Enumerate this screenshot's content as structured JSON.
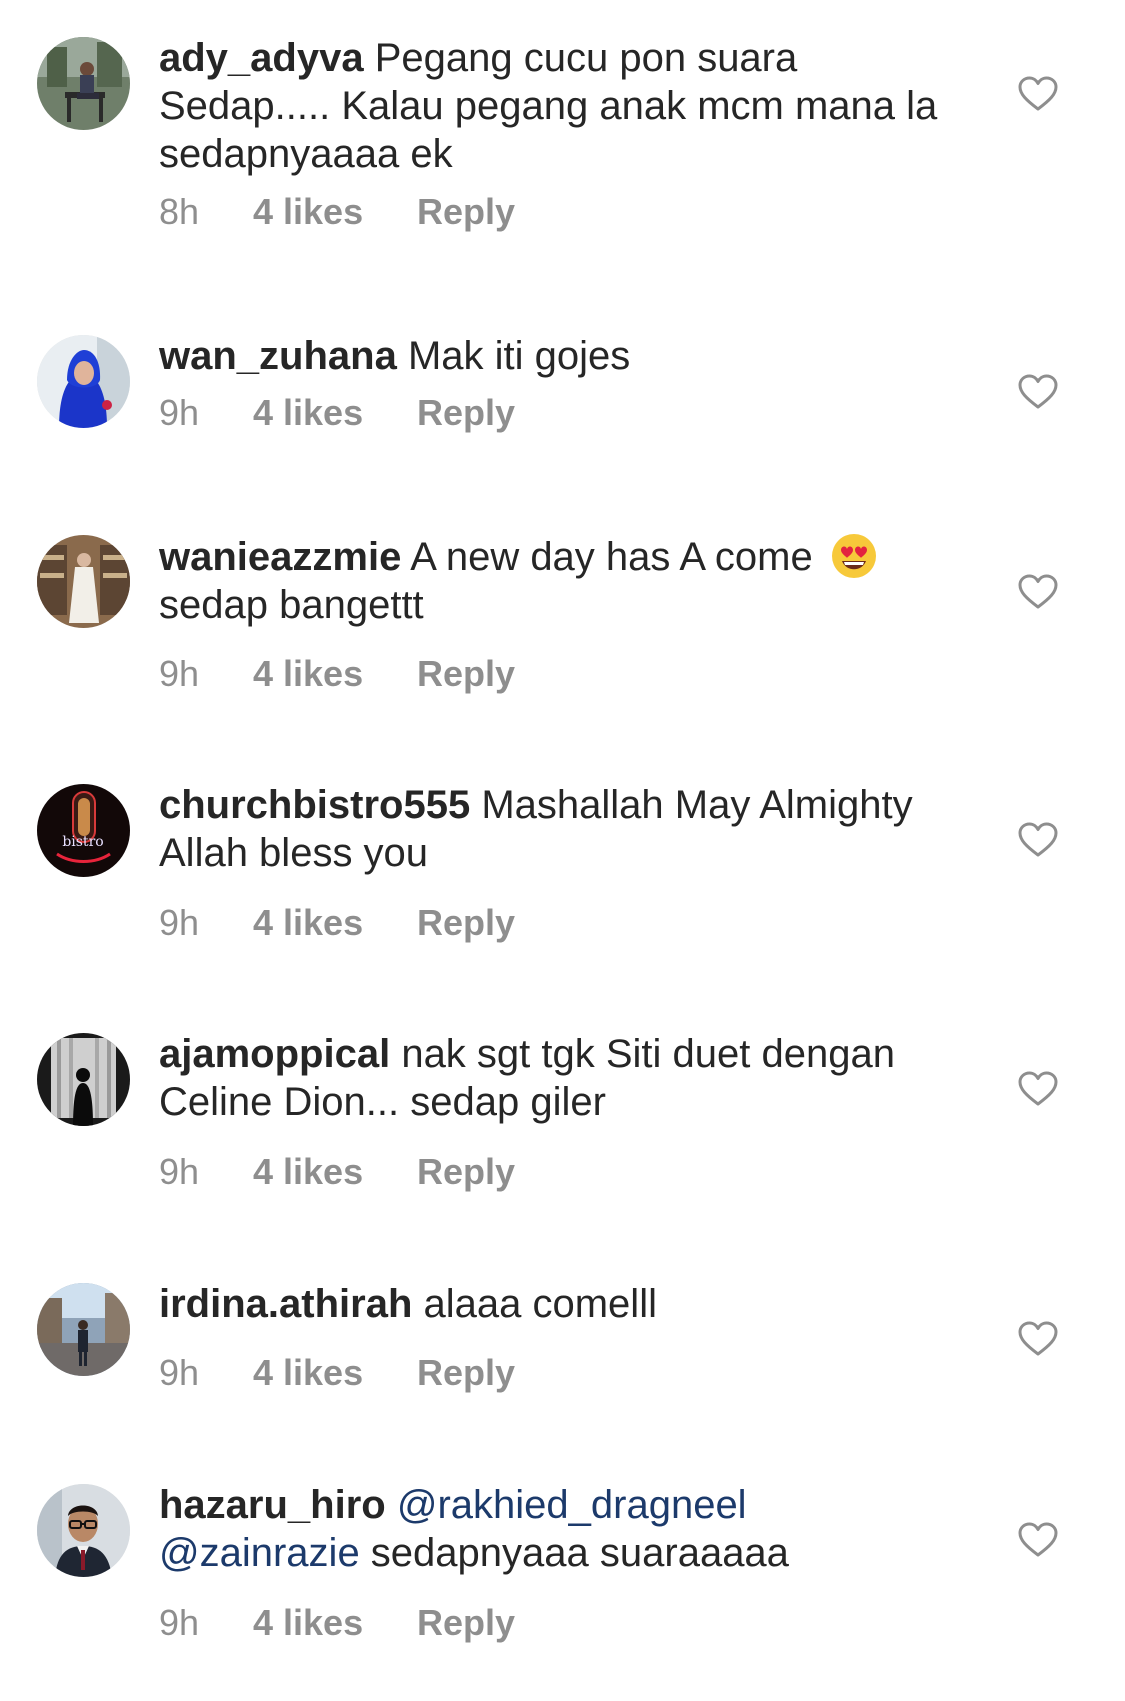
{
  "comments": [
    {
      "username": "ady_adyva",
      "text": " Pegang cucu pon suara Sedap..... Kalau pegang anak mcm mana la sedapnyaaaa ek",
      "time": "8h",
      "likes": "4 likes",
      "reply": "Reply",
      "avatar_icon": "avatar-man-sitting-bench"
    },
    {
      "username": "wan_zuhana",
      "text": " Mak iti gojes",
      "time": "9h",
      "likes": "4 likes",
      "reply": "Reply",
      "avatar_icon": "avatar-woman-blue-hijab"
    },
    {
      "username": "wanieazzmie",
      "text": " A new day has A come ",
      "text_after_emoji": "sedap bangettt",
      "emoji": "heart-eyes-emoji",
      "time": "9h",
      "likes": "4 likes",
      "reply": "Reply",
      "avatar_icon": "avatar-woman-white-dress-library"
    },
    {
      "username": "churchbistro555",
      "text": " Mashallah May Almighty Allah bless you",
      "time": "9h",
      "likes": "4 likes",
      "reply": "Reply",
      "avatar_icon": "avatar-bistro-neon-sign",
      "avatar_text": "bistro"
    },
    {
      "username": "ajamoppical",
      "text": " nak sgt tgk Siti duet dengan Celine Dion... sedap giler",
      "time": "9h",
      "likes": "4 likes",
      "reply": "Reply",
      "avatar_icon": "avatar-silhouette-window"
    },
    {
      "username": "irdina.athirah",
      "text": " alaaa comelll",
      "time": "9h",
      "likes": "4 likes",
      "reply": "Reply",
      "avatar_icon": "avatar-person-street"
    },
    {
      "username": "hazaru_hiro",
      "mention1": "@rakhied_dragneel",
      "mention2": "@zainrazie",
      "text": " sedapnyaaa suaraaaaa",
      "time": "9h",
      "likes": "4 likes",
      "reply": "Reply",
      "avatar_icon": "avatar-man-glasses-suit"
    }
  ],
  "colors": {
    "text": "#262626",
    "meta": "#8e8e8e",
    "mention": "#1c3a6b"
  }
}
